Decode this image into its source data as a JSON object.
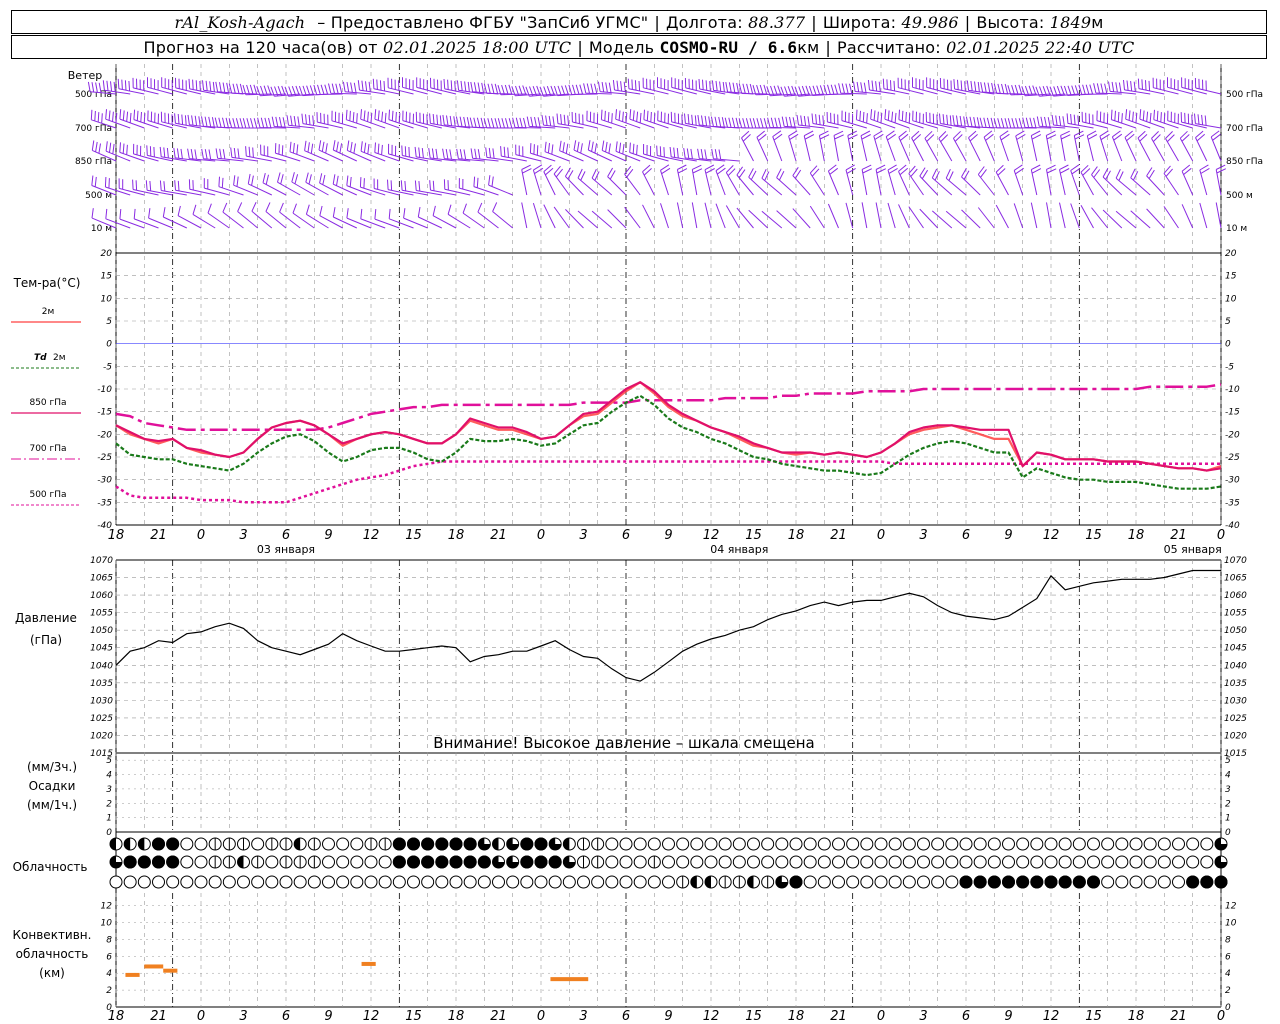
{
  "header": {
    "station": "rAl_Kosh-Agach",
    "provider": "– Предоставлено ФГБУ \"ЗапСиб УГМС\"",
    "lon_label": "Долгота:",
    "lon_value": "88.377",
    "lat_label": "Широта:",
    "lat_value": "49.986",
    "alt_label": "Высота:",
    "alt_value": "1849",
    "alt_unit": "м",
    "forecast_label": "Прогноз на 120 часа(ов) от",
    "forecast_start": "02.01.2025 18:00 UTC",
    "model_label": "Модель",
    "model_name": "COSMO-RU / 6.6",
    "model_unit": "км",
    "computed_label": "Рассчитано:",
    "computed_value": "02.01.2025 22:40 UTC"
  },
  "colors": {
    "wind": "#8a2be2",
    "t2m": "#ff4040",
    "td2m": "#1a7a1a",
    "t850": "#e0106a",
    "t700": "#e0109a",
    "t500": "#e0109a",
    "pressure": "#000000",
    "zero_line": "#4040ff",
    "convective": "#f08020",
    "grid": "#999999"
  },
  "wind_panel": {
    "title": "Ветер",
    "levels": [
      "500 гПа",
      "700 гПа",
      "850 гПа",
      "500 м",
      "10 м"
    ]
  },
  "temp_panel": {
    "title": "Тем-ра(°C)",
    "legend": [
      {
        "key": "t2m",
        "label": "2м",
        "style": "solid"
      },
      {
        "key": "td2m",
        "label_a": "Td",
        "label_b": "2м",
        "style": "dotted"
      },
      {
        "key": "t850",
        "label": "850 гПа",
        "style": "solid"
      },
      {
        "key": "t700",
        "label": "700 гПа",
        "style": "dashdot"
      },
      {
        "key": "t500",
        "label": "500 гПа",
        "style": "dashed"
      }
    ],
    "yticks": [
      20,
      15,
      10,
      5,
      0,
      -5,
      -10,
      -15,
      -20,
      -25,
      -30,
      -35,
      -40
    ]
  },
  "time_axis": {
    "hour_labels": [
      "18",
      "21",
      "0",
      "3",
      "6",
      "9",
      "12",
      "15",
      "18",
      "21",
      "0",
      "3",
      "6",
      "9",
      "12",
      "15",
      "18",
      "21",
      "0",
      "3",
      "6",
      "9",
      "12",
      "15",
      "18",
      "21",
      "0"
    ],
    "day_labels": [
      "03 января",
      "04 января",
      "05 января"
    ]
  },
  "pressure_panel": {
    "title_a": "Давление",
    "title_b": "(гПа)",
    "yticks": [
      1070,
      1065,
      1060,
      1055,
      1050,
      1045,
      1040,
      1035,
      1030,
      1025,
      1020,
      1015
    ],
    "warning": "Внимание! Высокое давление – шкала смещена"
  },
  "precip_panel": {
    "title_a": "(мм/3ч.)",
    "title_b": "Осадки",
    "title_c": "(мм/1ч.)",
    "yticks": [
      5,
      4,
      3,
      2,
      1,
      0
    ]
  },
  "cloud_panel": {
    "title": "Облачность"
  },
  "convective_panel": {
    "title_a": "Конвективн.",
    "title_b": "облачность",
    "title_c": "(км)",
    "yticks": [
      12,
      10,
      8,
      6,
      4,
      2,
      0
    ]
  },
  "chart_data": [
    {
      "type": "line",
      "title": "Тем-ра(°C)",
      "ylim": [
        -40,
        20
      ],
      "x_hours": [
        0,
        1.5,
        3,
        4.5,
        6,
        7.5,
        9,
        10.5,
        12,
        13.5,
        15,
        16.5,
        18,
        19.5,
        21,
        22.5,
        24,
        25.5,
        27,
        28.5,
        30,
        31.5,
        33,
        34.5,
        36,
        37.5,
        39,
        40.5,
        42,
        43.5,
        45,
        46.5,
        48,
        49.5,
        51,
        52.5,
        54,
        55.5,
        57,
        58.5,
        60,
        61.5,
        63,
        64.5,
        66,
        67.5,
        69,
        70.5,
        72,
        73.5,
        75,
        76.5,
        78,
        79.5,
        81,
        82.5,
        84,
        85.5,
        87,
        88.5,
        90,
        91.5,
        93,
        94.5,
        96,
        97.5,
        99,
        100.5,
        102,
        103.5,
        105,
        106.5,
        108,
        109.5,
        111,
        112.5,
        114,
        115.5,
        117
      ],
      "series": [
        {
          "name": "2м",
          "key": "t2m",
          "values": [
            -18,
            -20,
            -21,
            -22,
            -21,
            -23,
            -24,
            -24.5,
            -25,
            -24,
            -21,
            -18.5,
            -17.5,
            -17,
            -18,
            -20,
            -22.5,
            -21,
            -20,
            -19.5,
            -20,
            -21,
            -22,
            -22,
            -20,
            -17,
            -18,
            -19,
            -19,
            -20,
            -21,
            -20.5,
            -18,
            -16,
            -15.5,
            -13,
            -10.5,
            -8.5,
            -11,
            -14,
            -16,
            -17,
            -18.5,
            -19.5,
            -21,
            -22.5,
            -23,
            -24,
            -24.5,
            -24,
            -24.5,
            -24,
            -24.5,
            -25,
            -24,
            -22,
            -20,
            -19,
            -18.5,
            -18,
            -19,
            -20,
            -21,
            -21,
            -27,
            -24,
            -24.5,
            -25.5,
            -25.5,
            -25.5,
            -26,
            -26,
            -26,
            -26.5,
            -27,
            -27.5,
            -27.5,
            -28,
            -27
          ]
        },
        {
          "name": "Td 2м",
          "key": "td2m",
          "values": [
            -22,
            -24.5,
            -25,
            -25.5,
            -25.5,
            -26.5,
            -27,
            -27.5,
            -28,
            -26.5,
            -24,
            -22,
            -20.5,
            -20,
            -21.5,
            -24,
            -26,
            -25,
            -23.5,
            -23,
            -23,
            -24,
            -25.5,
            -26,
            -24,
            -21,
            -21.5,
            -21.5,
            -21,
            -21.5,
            -22.5,
            -22,
            -20,
            -18,
            -17.5,
            -15,
            -13,
            -11.5,
            -13.5,
            -16.5,
            -18.5,
            -19.5,
            -21,
            -22,
            -23.5,
            -25,
            -25.5,
            -26.5,
            -27,
            -27.5,
            -28,
            -28,
            -28.5,
            -29,
            -28.5,
            -26.5,
            -24.5,
            -23,
            -22,
            -21.5,
            -22,
            -23,
            -24,
            -24,
            -29.5,
            -27.5,
            -28.5,
            -29.5,
            -30,
            -30,
            -30.5,
            -30.5,
            -30.5,
            -31,
            -31.5,
            -32,
            -32,
            -32,
            -31.5
          ]
        },
        {
          "name": "850 гПа",
          "key": "t850",
          "values": [
            -18,
            -19.5,
            -21,
            -21.5,
            -21,
            -23,
            -23.5,
            -24.5,
            -25,
            -24,
            -21,
            -18.5,
            -17.5,
            -17,
            -18,
            -20,
            -22,
            -21,
            -20,
            -19.5,
            -20,
            -21,
            -22,
            -22,
            -20,
            -16.5,
            -17.5,
            -18.5,
            -18.5,
            -19.5,
            -21,
            -20.5,
            -18,
            -15.5,
            -15,
            -12.5,
            -10,
            -8.5,
            -10.5,
            -13.5,
            -15.5,
            -17,
            -18.5,
            -19.5,
            -20.5,
            -22,
            -23,
            -24,
            -24,
            -24,
            -24.5,
            -24,
            -24.5,
            -25,
            -24,
            -22,
            -19.5,
            -18.5,
            -18,
            -18,
            -18.5,
            -19,
            -19,
            -19,
            -27,
            -24,
            -24.5,
            -25.5,
            -25.5,
            -25.5,
            -26,
            -26,
            -26,
            -26.5,
            -27,
            -27.5,
            -27.5,
            -28,
            -27.5
          ]
        },
        {
          "name": "700 гПа",
          "key": "t700",
          "values": [
            -15.5,
            -16,
            -17.5,
            -18,
            -18.5,
            -19,
            -19,
            -19,
            -19,
            -19,
            -19,
            -19,
            -19,
            -19,
            -19,
            -18.5,
            -17.5,
            -16.5,
            -15.5,
            -15,
            -14.5,
            -14,
            -14,
            -13.5,
            -13.5,
            -13.5,
            -13.5,
            -13.5,
            -13.5,
            -13.5,
            -13.5,
            -13.5,
            -13.5,
            -13,
            -13,
            -13,
            -13,
            -12.5,
            -12.5,
            -12.5,
            -12.5,
            -12.5,
            -12.5,
            -12,
            -12,
            -12,
            -12,
            -11.5,
            -11.5,
            -11,
            -11,
            -11,
            -11,
            -10.5,
            -10.5,
            -10.5,
            -10.5,
            -10,
            -10,
            -10,
            -10,
            -10,
            -10,
            -10,
            -10,
            -10,
            -10,
            -10,
            -10,
            -10,
            -10,
            -10,
            -10,
            -9.5,
            -9.5,
            -9.5,
            -9.5,
            -9.5,
            -9
          ]
        },
        {
          "name": "500 гПа",
          "key": "t500",
          "values": [
            -31.5,
            -33.5,
            -34,
            -34,
            -34,
            -34,
            -34.5,
            -34.5,
            -34.5,
            -35,
            -35,
            -35,
            -35,
            -34,
            -33,
            -32,
            -31,
            -30,
            -29.5,
            -29,
            -28,
            -27,
            -26.5,
            -26,
            -26,
            -26,
            -26,
            -26,
            -26,
            -26,
            -26,
            -26,
            -26,
            -26,
            -26,
            -26,
            -26,
            -26,
            -26,
            -26,
            -26,
            -26,
            -26,
            -26,
            -26,
            -26,
            -26,
            -26,
            -26,
            -26,
            -26,
            -26,
            -26,
            -26,
            -26,
            -26.5,
            -26.5,
            -26.5,
            -26.5,
            -26.5,
            -26.5,
            -26.5,
            -26.5,
            -26.5,
            -26.5,
            -26.5,
            -26.5,
            -26.5,
            -26.5,
            -26.5,
            -26.5,
            -26.5,
            -26.5,
            -26.5,
            -26.5,
            -26.5,
            -26.5,
            -26.5,
            -26.5
          ]
        }
      ]
    },
    {
      "type": "line",
      "title": "Давление",
      "ylabel": "(гПа)",
      "ylim": [
        1015,
        1070
      ],
      "x_hours": [
        0,
        1.5,
        3,
        4.5,
        6,
        7.5,
        9,
        10.5,
        12,
        13.5,
        15,
        16.5,
        18,
        19.5,
        21,
        22.5,
        24,
        25.5,
        27,
        28.5,
        30,
        31.5,
        33,
        34.5,
        36,
        37.5,
        39,
        40.5,
        42,
        43.5,
        45,
        46.5,
        48,
        49.5,
        51,
        52.5,
        54,
        55.5,
        57,
        58.5,
        60,
        61.5,
        63,
        64.5,
        66,
        67.5,
        69,
        70.5,
        72,
        73.5,
        75,
        76.5,
        78,
        79.5,
        81,
        82.5,
        84,
        85.5,
        87,
        88.5,
        90,
        91.5,
        93,
        94.5,
        96,
        97.5,
        99,
        100.5,
        102,
        103.5,
        105,
        106.5,
        108,
        109.5,
        111,
        112.5,
        114,
        115.5,
        117
      ],
      "series": [
        {
          "name": "Давление",
          "key": "pressure",
          "values": [
            1040,
            1044,
            1045,
            1047,
            1046.5,
            1049,
            1049.5,
            1051,
            1052,
            1050.5,
            1047,
            1045,
            1044,
            1043,
            1044.5,
            1046,
            1049,
            1047,
            1045.5,
            1044,
            1044,
            1044.5,
            1045,
            1045.5,
            1045,
            1041,
            1042.5,
            1043,
            1044,
            1044,
            1045.5,
            1047,
            1044.5,
            1042.5,
            1042,
            1039,
            1036.5,
            1035.5,
            1038,
            1041,
            1044,
            1046,
            1047.5,
            1048.5,
            1050,
            1051,
            1053,
            1054.5,
            1055.5,
            1057,
            1058,
            1057,
            1058,
            1058.5,
            1058.5,
            1059.5,
            1060.5,
            1059.5,
            1057,
            1055,
            1054,
            1053.5,
            1053,
            1054,
            1056.5,
            1059,
            1065.5,
            1061.5,
            1062.5,
            1063.5,
            1064,
            1064.5,
            1064.5,
            1064.5,
            1065,
            1066,
            1067,
            1067,
            1067
          ]
        }
      ]
    },
    {
      "type": "bar",
      "title": "Конвективн. облачность (км)",
      "ylim": [
        0,
        13
      ],
      "segments": [
        {
          "start_h": 1,
          "end_h": 2.5,
          "value_km": 3.8
        },
        {
          "start_h": 3,
          "end_h": 5,
          "value_km": 4.8
        },
        {
          "start_h": 5,
          "end_h": 6.5,
          "value_km": 4.3
        },
        {
          "start_h": 26,
          "end_h": 27.5,
          "value_km": 5.1
        },
        {
          "start_h": 46,
          "end_h": 50,
          "value_km": 3.3
        }
      ]
    },
    {
      "type": "table",
      "title": "Облачность",
      "rows_fill": [
        [
          2,
          2,
          2,
          4,
          4,
          0,
          0,
          1,
          1,
          1,
          0,
          1,
          1,
          2,
          1,
          0,
          0,
          0,
          1,
          1,
          4,
          4,
          4,
          4,
          4,
          4,
          3,
          2,
          3,
          4,
          4,
          3,
          2,
          1,
          1,
          0,
          0,
          0,
          0,
          0,
          0,
          0,
          0,
          0,
          0,
          0,
          0,
          0,
          0,
          0,
          0,
          0,
          0,
          0,
          0,
          0,
          0,
          0,
          0,
          0,
          0,
          0,
          0,
          0,
          0,
          0,
          0,
          0,
          0,
          0,
          0,
          0,
          0,
          0,
          0,
          0,
          0,
          0,
          3
        ],
        [
          3,
          4,
          4,
          4,
          4,
          0,
          0,
          1,
          1,
          2,
          1,
          0,
          1,
          1,
          1,
          0,
          0,
          0,
          0,
          0,
          4,
          4,
          4,
          4,
          4,
          4,
          4,
          3,
          3,
          4,
          4,
          4,
          3,
          1,
          1,
          0,
          0,
          0,
          1,
          0,
          0,
          0,
          0,
          0,
          0,
          0,
          0,
          0,
          0,
          0,
          0,
          0,
          0,
          0,
          0,
          0,
          0,
          0,
          0,
          0,
          0,
          0,
          0,
          0,
          0,
          0,
          0,
          0,
          0,
          0,
          0,
          0,
          0,
          0,
          0,
          0,
          0,
          0,
          3
        ],
        [
          0,
          0,
          0,
          0,
          0,
          0,
          0,
          0,
          0,
          0,
          0,
          0,
          0,
          0,
          0,
          0,
          0,
          0,
          0,
          0,
          0,
          0,
          0,
          0,
          0,
          0,
          0,
          0,
          0,
          0,
          0,
          0,
          0,
          0,
          0,
          0,
          0,
          0,
          0,
          0,
          1,
          2,
          2,
          1,
          1,
          2,
          1,
          3,
          4,
          0,
          0,
          0,
          0,
          0,
          0,
          0,
          0,
          0,
          0,
          0,
          4,
          4,
          4,
          4,
          4,
          4,
          4,
          4,
          4,
          4,
          0,
          0,
          0,
          0,
          0,
          0,
          4,
          4,
          4
        ]
      ]
    }
  ]
}
